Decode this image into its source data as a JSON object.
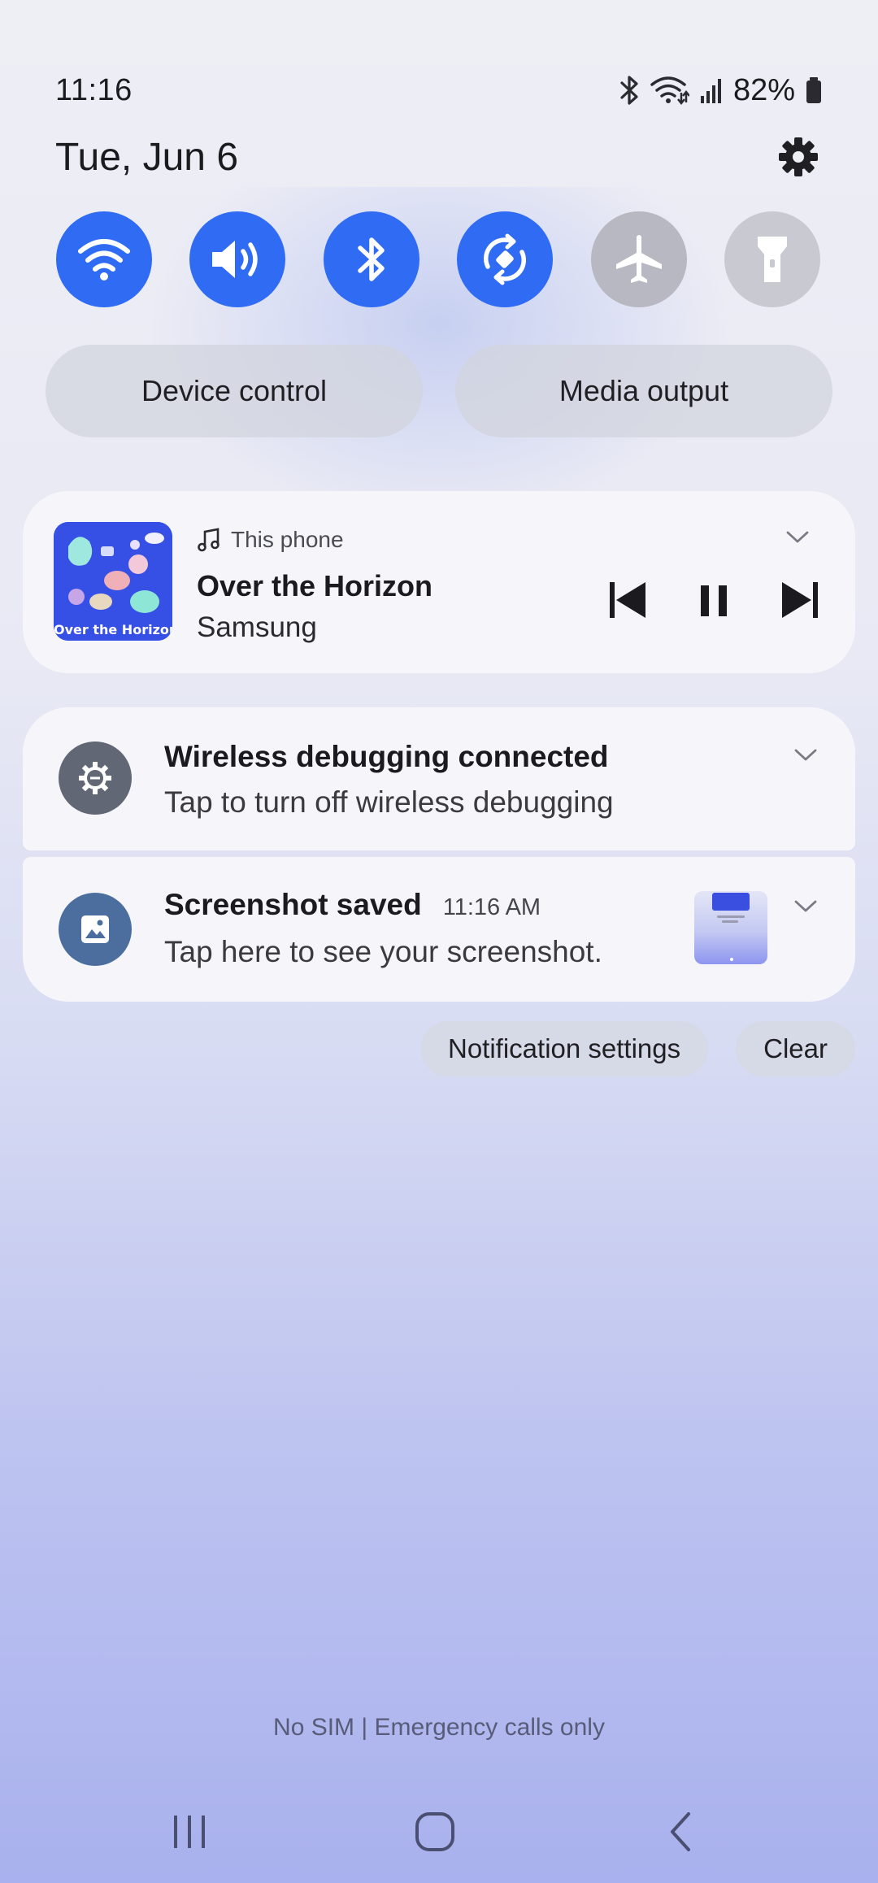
{
  "status_bar": {
    "time": "11:16",
    "battery_percent": "82%",
    "icons": [
      "bluetooth-icon",
      "wifi-data-icon",
      "signal-icon",
      "battery-icon"
    ]
  },
  "header": {
    "date": "Tue, Jun 6",
    "settings_icon": "gear-icon"
  },
  "quick_toggles": [
    {
      "icon": "wifi-icon",
      "state": "on"
    },
    {
      "icon": "sound-icon",
      "state": "on"
    },
    {
      "icon": "bluetooth-icon",
      "state": "on"
    },
    {
      "icon": "auto-rotate-icon",
      "state": "on"
    },
    {
      "icon": "airplane-mode-icon",
      "state": "off"
    },
    {
      "icon": "flashlight-icon",
      "state": "off"
    }
  ],
  "pills": {
    "device_control": "Device control",
    "media_output": "Media output"
  },
  "media": {
    "source": "This phone",
    "title": "Over the Horizon",
    "artist": "Samsung",
    "album_art_text": "Over the Horizon"
  },
  "notifications": [
    {
      "title": "Wireless debugging connected",
      "text": "Tap to turn off wireless debugging",
      "icon": "debug-gear-icon"
    },
    {
      "title": "Screenshot saved",
      "time": "11:16 AM",
      "text": "Tap here to see your screenshot.",
      "icon": "image-icon"
    }
  ],
  "actions": {
    "notification_settings": "Notification settings",
    "clear": "Clear"
  },
  "carrier_text": "No SIM | Emergency calls only",
  "colors": {
    "accent": "#2f6cf3",
    "toggle_off": "#b7b8c1",
    "card_bg": "#f6f6fa"
  }
}
